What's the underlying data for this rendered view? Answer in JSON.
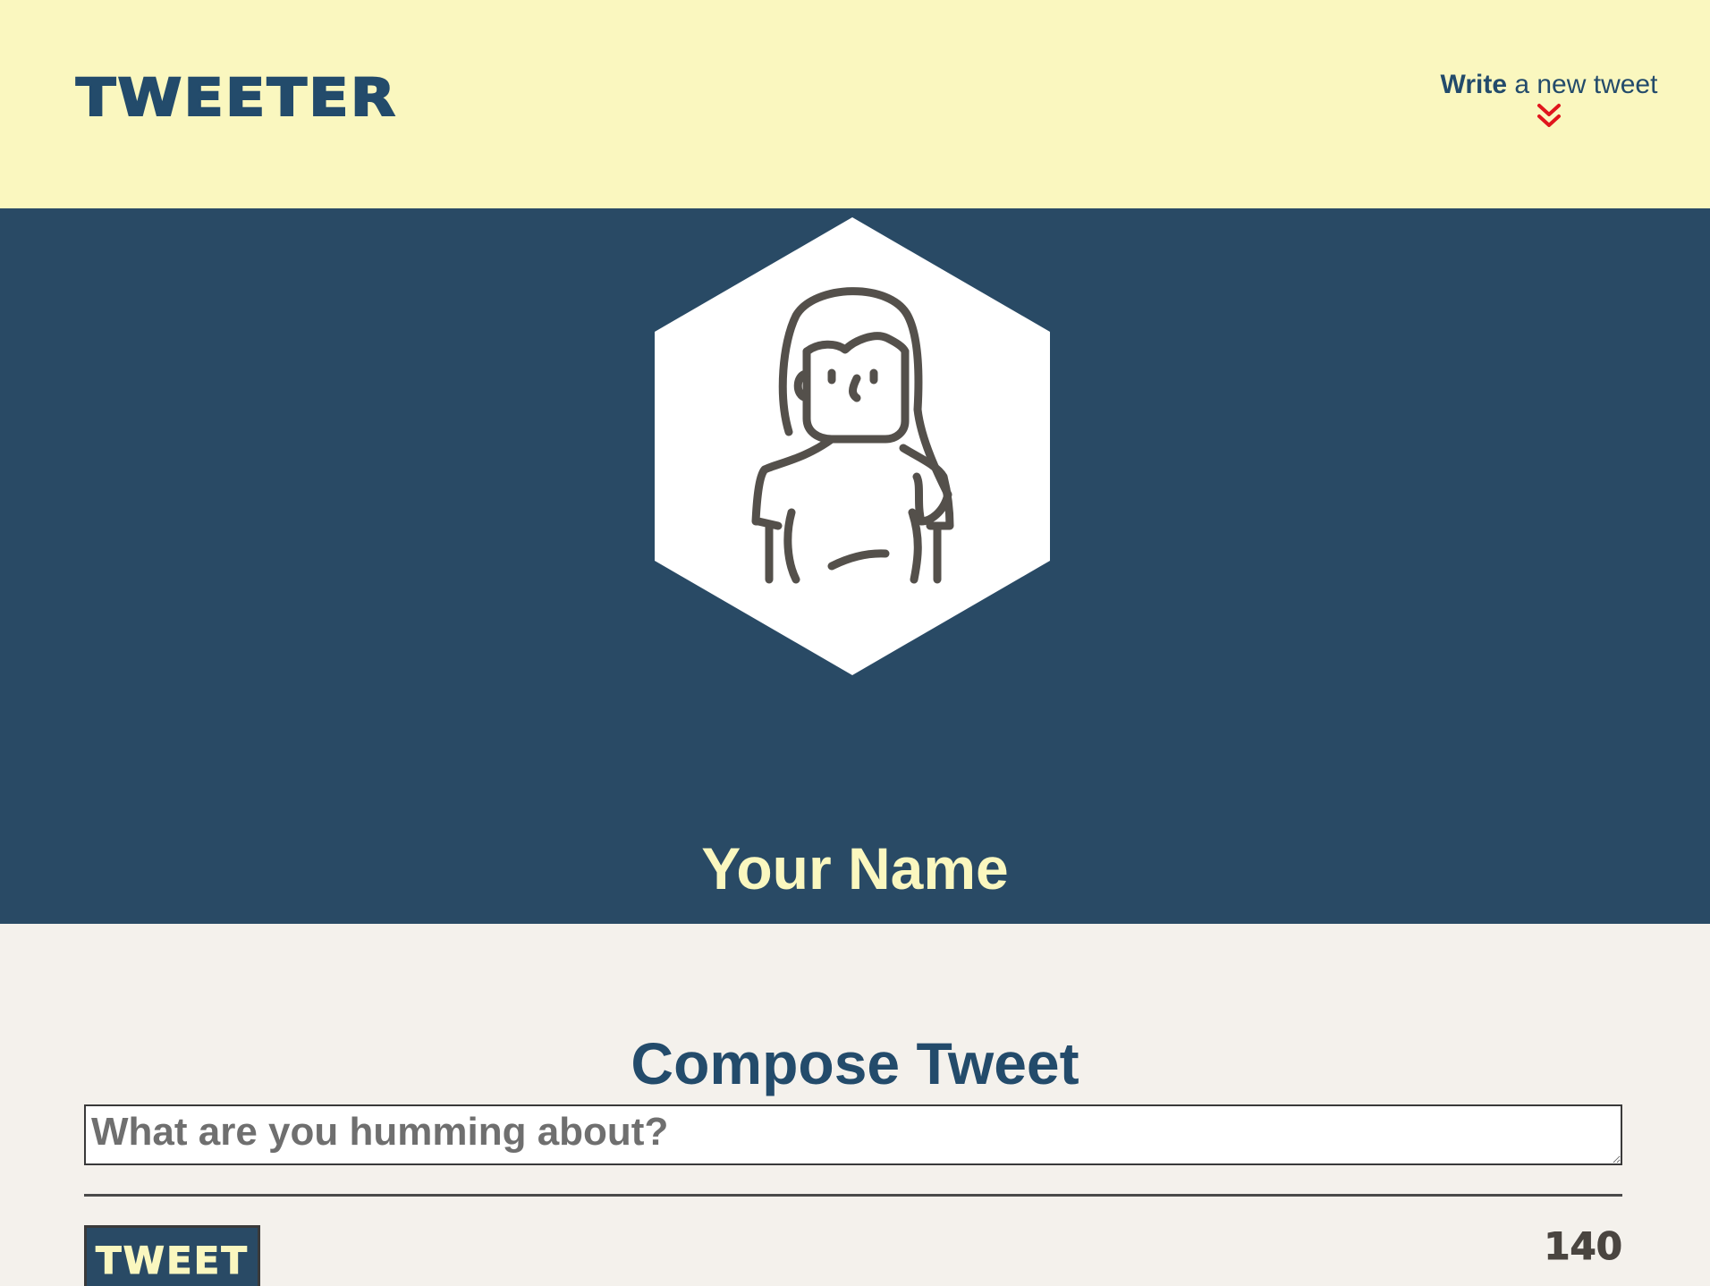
{
  "nav": {
    "brand": "TWEETER",
    "compose_toggle": {
      "bold": "Write",
      "rest": " a new tweet",
      "icon": "double-chevron-down-icon"
    }
  },
  "profile": {
    "avatar_icon": "user-avatar-icon",
    "name": "Your Name"
  },
  "compose": {
    "title": "Compose Tweet",
    "input_placeholder": "What are you humming about?",
    "input_value": "",
    "button_label": "TWEET",
    "char_counter": "140"
  },
  "colors": {
    "nav_bg": "#faf7bf",
    "header_bg": "#294a65",
    "accent_text": "#234b6b",
    "name_text": "#faf7bf",
    "page_bg": "#f4f1ec",
    "chevron": "#e0161d"
  }
}
